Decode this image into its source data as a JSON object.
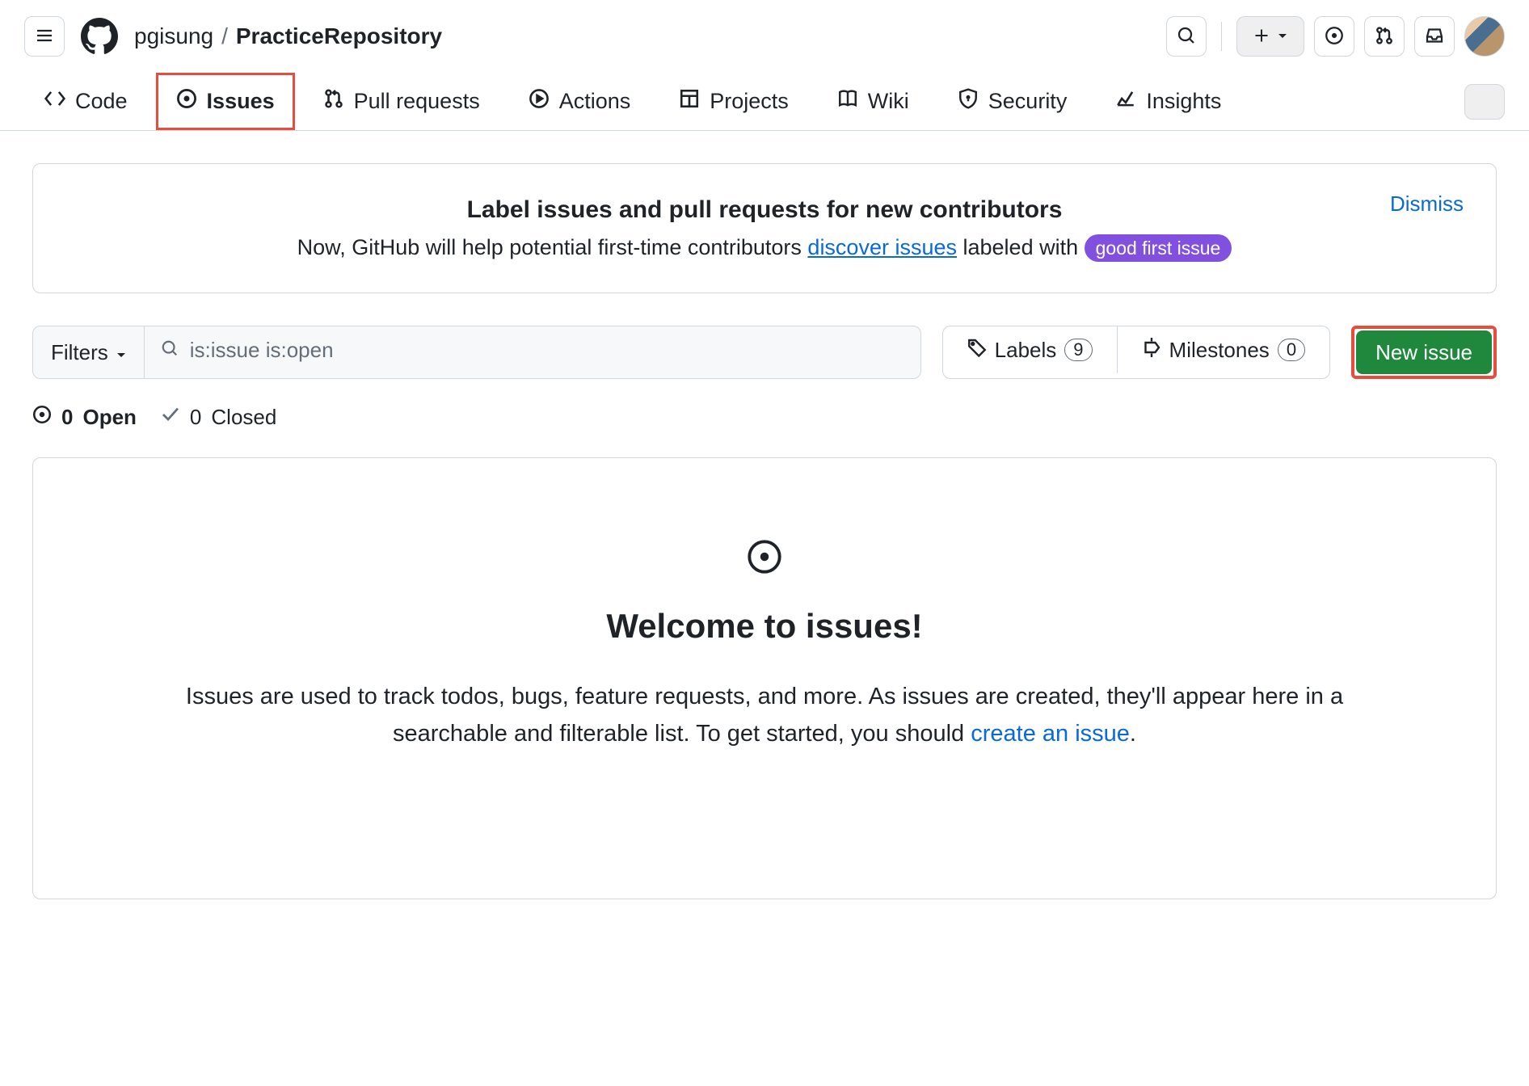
{
  "header": {
    "owner": "pgisung",
    "repo": "PracticeRepository",
    "sep": "/"
  },
  "tabs": [
    {
      "label": "Code"
    },
    {
      "label": "Issues"
    },
    {
      "label": "Pull requests"
    },
    {
      "label": "Actions"
    },
    {
      "label": "Projects"
    },
    {
      "label": "Wiki"
    },
    {
      "label": "Security"
    },
    {
      "label": "Insights"
    }
  ],
  "notice": {
    "title": "Label issues and pull requests for new contributors",
    "text_before": "Now, GitHub will help potential first-time contributors ",
    "link": "discover issues",
    "text_after": " labeled with ",
    "badge": "good first issue",
    "dismiss": "Dismiss"
  },
  "toolbar": {
    "filters_label": "Filters",
    "search_value": "is:issue is:open",
    "labels_label": "Labels",
    "labels_count": "9",
    "milestones_label": "Milestones",
    "milestones_count": "0",
    "new_issue": "New issue"
  },
  "states": {
    "open_count": "0",
    "open_label": "Open",
    "closed_count": "0",
    "closed_label": "Closed"
  },
  "blank": {
    "title": "Welcome to issues!",
    "text_before": "Issues are used to track todos, bugs, feature requests, and more. As issues are created, they'll appear here in a searchable and filterable list. To get started, you should ",
    "link": "create an issue",
    "text_after": "."
  }
}
